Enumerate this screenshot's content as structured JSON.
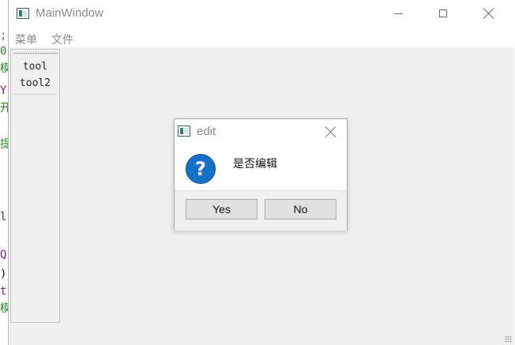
{
  "main_window": {
    "title": "MainWindow",
    "icon": "app-window-icon",
    "menus": [
      "菜单",
      "文件"
    ],
    "toolbar_items": [
      "tool",
      "tool2"
    ]
  },
  "dialog": {
    "title": "edit",
    "message": "是否编辑",
    "icon": "question-icon",
    "buttons": {
      "yes": "Yes",
      "no": "No"
    }
  },
  "background_code_fragments": [
    ";",
    "0",
    "模",
    "Y",
    "开",
    "提",
    "l",
    "Q",
    ")",
    "t",
    "模"
  ],
  "colors": {
    "question_icon": "#1470c8",
    "dialog_footer": "#f0f0f0",
    "window_bg": "#f0f0f0"
  }
}
